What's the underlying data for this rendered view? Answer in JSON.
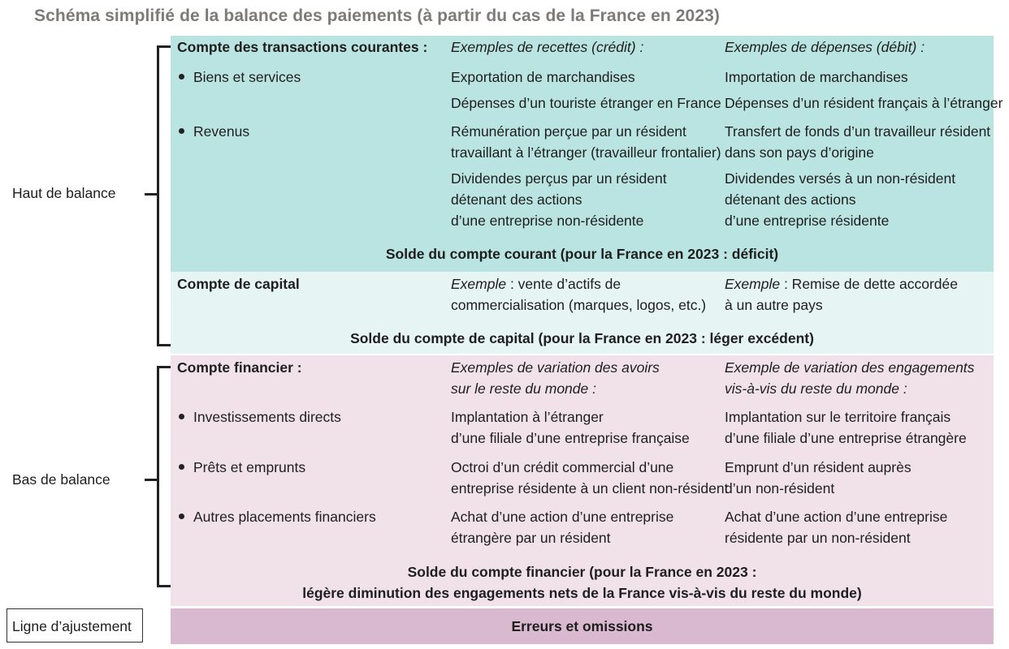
{
  "title": "Schéma simplifié de la balance des paiements (à partir du cas de la France en 2023)",
  "side": {
    "haut": "Haut de balance",
    "bas": "Bas de balance",
    "ajustement": "Ligne d’ajustement"
  },
  "courant": {
    "heading": "Compte des transactions courantes :",
    "col_recettes": "Exemples de recettes (crédit) :",
    "col_depenses": "Exemples de dépenses (débit) :",
    "biens_label": "Biens et services",
    "biens_credit_1": "Exportation de marchandises",
    "biens_debit_1": "Importation de marchandises",
    "biens_credit_2": "Dépenses d’un touriste étranger en France",
    "biens_debit_2": "Dépenses d’un résident français à l’étranger",
    "revenus_label": "Revenus",
    "rev_credit_1": [
      "Rémunération perçue par un résident",
      "travaillant à l’étranger (travailleur frontalier)"
    ],
    "rev_debit_1": [
      "Transfert de fonds d’un travailleur résident",
      "dans son pays d’origine"
    ],
    "rev_credit_2": [
      "Dividendes perçus par un résident",
      "détenant des actions",
      "d’une entreprise non-résidente"
    ],
    "rev_debit_2": [
      "Dividendes versés à un non-résident",
      "détenant des actions",
      "d’une entreprise résidente"
    ],
    "solde": "Solde du compte courant (pour la France en 2023 : déficit)"
  },
  "capital": {
    "heading": "Compte de capital",
    "ex_word": "Exemple",
    "credit": [
      " : vente d’actifs de",
      "commercialisation (marques, logos, etc.)"
    ],
    "debit": [
      " : Remise de dette accordée",
      "à un autre pays"
    ],
    "solde": "Solde du compte de capital (pour la France en 2023 : léger excédent)"
  },
  "financier": {
    "heading": "Compte financier :",
    "col_avoirs": [
      "Exemples de variation des avoirs",
      "sur le reste du monde :"
    ],
    "col_engagements": [
      "Exemple de variation des engagements",
      "vis-à-vis du reste du monde :"
    ],
    "idd_label": "Investissements directs",
    "idd_avoirs": [
      "Implantation à l’étranger",
      "d’une filiale d’une entreprise française"
    ],
    "idd_engag": [
      "Implantation sur le territoire français",
      "d’une filiale d’une entreprise étrangère"
    ],
    "prets_label": "Prêts et emprunts",
    "prets_avoirs": [
      "Octroi d’un crédit commercial d’une",
      "entreprise résidente à un client non-résident"
    ],
    "prets_engag": [
      "Emprunt d’un résident auprès",
      "d’un non-résident"
    ],
    "autres_label": "Autres placements financiers",
    "autres_avoirs": [
      "Achat d’une action d’une entreprise",
      "étrangère par un résident"
    ],
    "autres_engag": [
      "Achat d’une action d’une entreprise",
      "résidente par un non-résident"
    ],
    "solde": [
      "Solde du compte financier (pour la France en 2023 :",
      "légère diminution des engagements nets de la France vis-à-vis du reste du monde)"
    ]
  },
  "erreurs": "Erreurs et omissions"
}
